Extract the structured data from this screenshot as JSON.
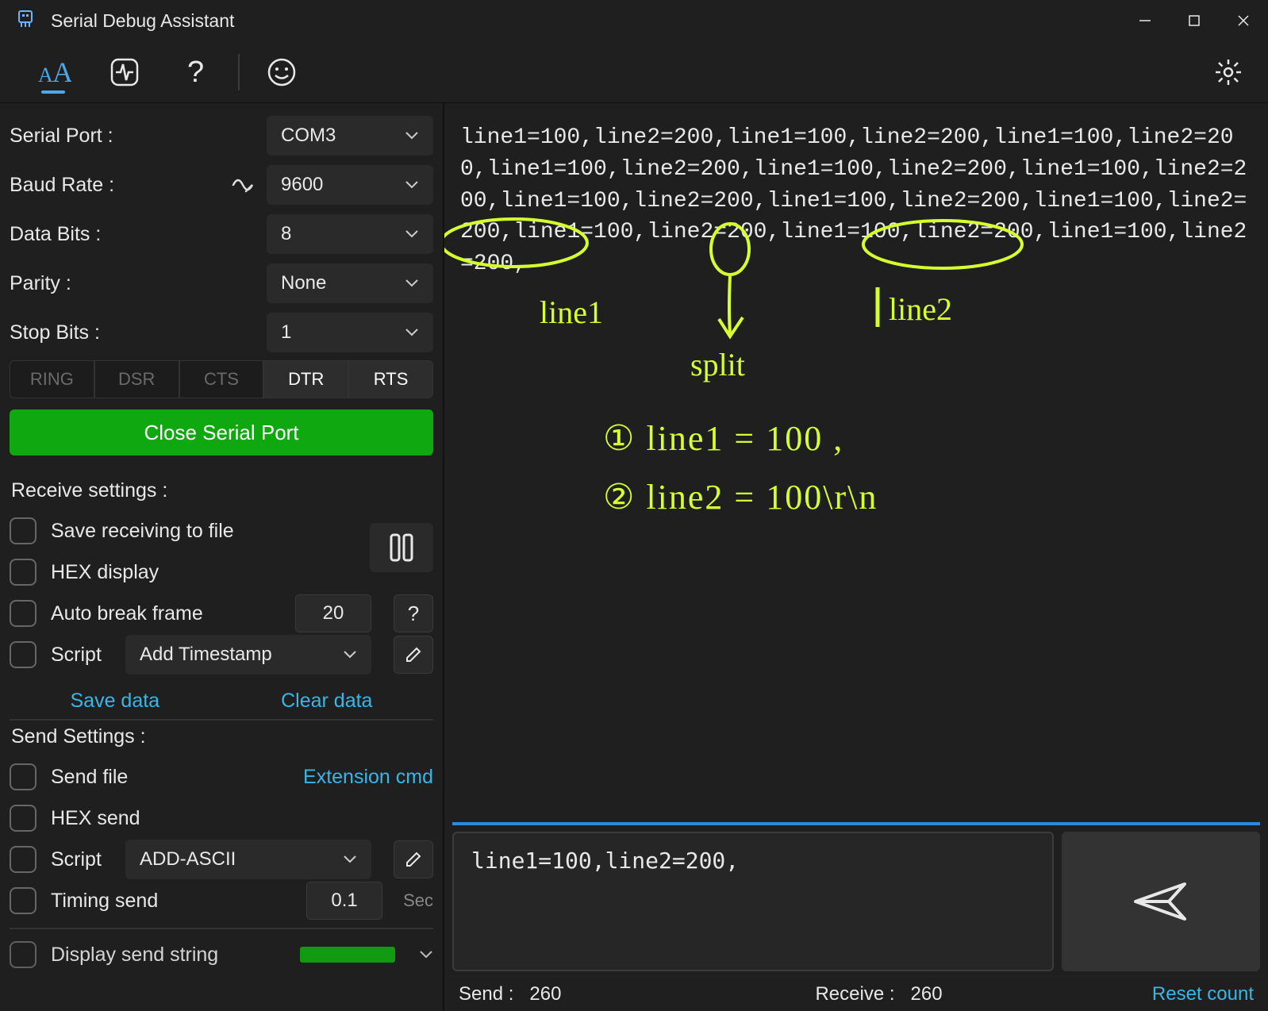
{
  "titlebar": {
    "title": "Serial Debug Assistant"
  },
  "sidebar": {
    "port_label": "Serial Port :",
    "port_value": "COM3",
    "baud_label": "Baud Rate :",
    "baud_value": "9600",
    "databits_label": "Data Bits :",
    "databits_value": "8",
    "parity_label": "Parity :",
    "parity_value": "None",
    "stopbits_label": "Stop Bits :",
    "stopbits_value": "1",
    "pills": {
      "ring": "RING",
      "dsr": "DSR",
      "cts": "CTS",
      "dtr": "DTR",
      "rts": "RTS"
    },
    "close_btn": "Close Serial Port",
    "recv_section": "Receive settings :",
    "recv": {
      "save_file": "Save receiving to file",
      "hex_display": "HEX display",
      "auto_break": "Auto break frame",
      "auto_break_value": "20",
      "help": "?",
      "script_label": "Script",
      "script_select": "Add Timestamp",
      "save_data": "Save data",
      "clear_data": "Clear data"
    },
    "send_section": "Send Settings :",
    "send": {
      "send_file": "Send file",
      "ext_cmd": "Extension cmd",
      "hex_send": "HEX send",
      "script_label": "Script",
      "script_select": "ADD-ASCII",
      "timing_send": "Timing send",
      "timing_value": "0.1",
      "timing_unit": "Sec",
      "display_string": "Display send string"
    }
  },
  "main": {
    "received_text": "line1=100,line2=200,line1=100,line2=200,line1=100,line2=200,line1=100,line2=200,line1=100,line2=200,line1=100,line2=200,line1=100,line2=200,line1=100,line2=200,line1=100,line2=200,line1=100,line2=200,line1=100,line2=200,line1=100,line2=200,",
    "annotations": {
      "a1": "line1",
      "a2": "split",
      "a3": "line2",
      "n1": "①  line1 = 100 ,",
      "n2": "②  line2 = 100\\r\\n"
    },
    "send_input": "line1=100,line2=200,",
    "status": {
      "send_label": "Send :",
      "send_value": "260",
      "recv_label": "Receive :",
      "recv_value": "260",
      "reset": "Reset count"
    }
  }
}
